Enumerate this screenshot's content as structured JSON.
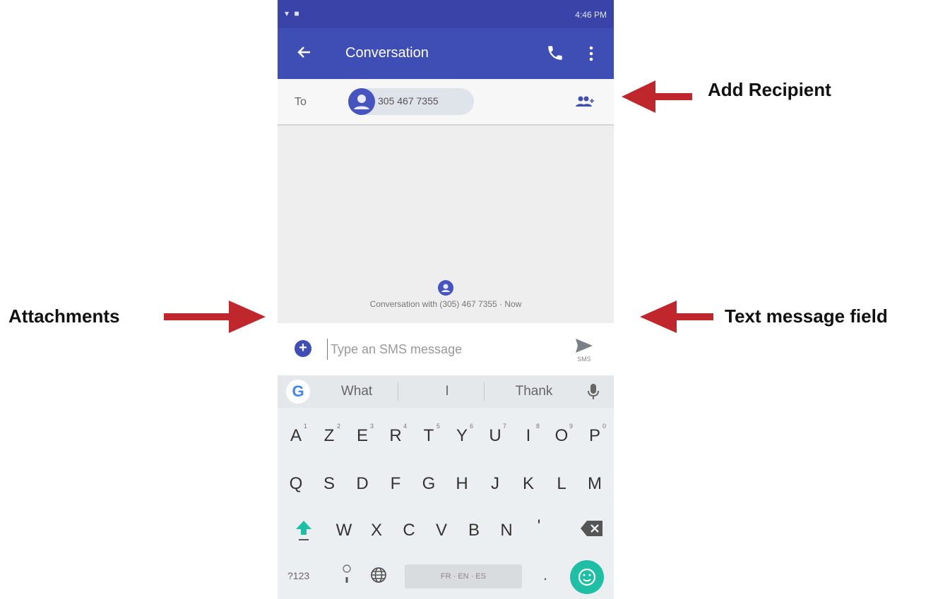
{
  "status_bar": {
    "left_icons": "▾ ■",
    "right_text": "4:46 PM"
  },
  "app_bar": {
    "title": "Conversation"
  },
  "recipient_bar": {
    "to_label": "To",
    "chip_number": "305 467 7355"
  },
  "conversation": {
    "info_text": "Conversation with (305) 467 7355 · Now"
  },
  "compose": {
    "placeholder": "Type an SMS message",
    "send_label": "SMS"
  },
  "keyboard": {
    "suggestions": [
      "What",
      "I",
      "Thank"
    ],
    "row1": [
      {
        "key": "A",
        "hint": "1"
      },
      {
        "key": "Z",
        "hint": "2"
      },
      {
        "key": "E",
        "hint": "3"
      },
      {
        "key": "R",
        "hint": "4"
      },
      {
        "key": "T",
        "hint": "5"
      },
      {
        "key": "Y",
        "hint": "6"
      },
      {
        "key": "U",
        "hint": "7"
      },
      {
        "key": "I",
        "hint": "8"
      },
      {
        "key": "O",
        "hint": "9"
      },
      {
        "key": "P",
        "hint": "0"
      }
    ],
    "row2": [
      "Q",
      "S",
      "D",
      "F",
      "G",
      "H",
      "J",
      "K",
      "L",
      "M"
    ],
    "row3": [
      "W",
      "X",
      "C",
      "V",
      "B",
      "N",
      "'"
    ],
    "symbols_key": "?123",
    "space_label": "FR · EN · ES",
    "period_key": "."
  },
  "annotations": {
    "add_recipient": "Add Recipient",
    "attachments": "Attachments",
    "text_message_field": "Text message field"
  },
  "colors": {
    "app_bar": "#3f4eb5",
    "status_bar": "#3a44a8",
    "annotation_arrow": "#c0272d",
    "enter_key": "#1ebfa5"
  }
}
